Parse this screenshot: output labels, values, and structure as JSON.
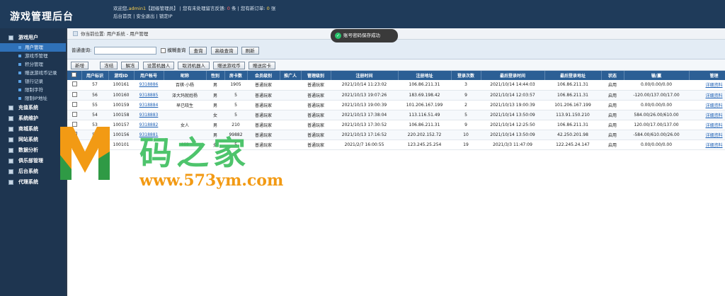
{
  "app": {
    "title": "游戏管理后台"
  },
  "header": {
    "welcome_prefix": "欢迎您,",
    "user": "admin1",
    "role": "【超级管理员】",
    "sep1": "|",
    "msg_prefix": "您有未处理留言反馈:",
    "msg_count": "0",
    "msg_suffix": "条",
    "sep2": "|",
    "order_prefix": "您有新订单:",
    "order_count": "0",
    "order_suffix": "张",
    "links": [
      "后台首页",
      "|",
      "安全退出",
      "|",
      "锁定IP"
    ]
  },
  "sidebar": {
    "groups": [
      {
        "label": "游戏用户",
        "subs": [
          "用户管理",
          "游戏币管理",
          "积分管理",
          "赠送游戏币记录",
          "银行记录",
          "限制字符",
          "限制IP地址"
        ]
      },
      {
        "label": "充值系统"
      },
      {
        "label": "系统维护"
      },
      {
        "label": "商城系统"
      },
      {
        "label": "网站系统"
      },
      {
        "label": "数据分析"
      },
      {
        "label": "俱乐部管理"
      },
      {
        "label": "后台系统"
      },
      {
        "label": "代理系统"
      }
    ],
    "active_sub": "用户管理"
  },
  "breadcrumb": "你当前位置: 用户系统 - 用户管理",
  "search": {
    "label": "普通查询:",
    "value": "",
    "fuzzy_label": "模糊查询",
    "query_btn": "查询",
    "advanced_btn": "高级查询",
    "refresh_btn": "刷新"
  },
  "toolbar": {
    "buttons": [
      "新增",
      "冻结",
      "解冻",
      "设置机器人",
      "取消机器人",
      "赠送游戏币",
      "赠送房卡"
    ]
  },
  "toast": "账号密码保存成功",
  "table": {
    "headers": [
      "",
      "用户标识",
      "游戏ID",
      "用户帐号",
      "昵称",
      "性别",
      "房卡数",
      "会员级别",
      "推广人",
      "管理级别",
      "注册时间",
      "注册地址",
      "登录次数",
      "最后登录时间",
      "最后登录地址",
      "状态",
      "输/赢",
      "管理"
    ],
    "rows": [
      [
        "",
        "57",
        "100161",
        "9318886",
        "百棋·小杨",
        "男",
        "1905",
        "普通玩家",
        "",
        "普通玩家",
        "2021/10/14 11:23:02",
        "106.86.211.31",
        "3",
        "2021/10/14 14:44:03",
        "106.86.211.31",
        "启用",
        "0.00/0.00/0.00",
        "详细资料"
      ],
      [
        "",
        "56",
        "100160",
        "9318885",
        "泽大玛就姓杨",
        "男",
        "5",
        "普通玩家",
        "",
        "普通玩家",
        "2021/10/13 19:07:26",
        "183.69.198.42",
        "9",
        "2021/10/14 12:03:57",
        "106.86.211.31",
        "启用",
        "-120.00/137.00/17.00",
        "详细资料"
      ],
      [
        "",
        "55",
        "100159",
        "9318884",
        "早已晓生",
        "男",
        "5",
        "普通玩家",
        "",
        "普通玩家",
        "2021/10/13 19:00:39",
        "101.206.167.199",
        "2",
        "2021/10/13 19:00:39",
        "101.206.167.199",
        "启用",
        "0.00/0.00/0.00",
        "详细资料"
      ],
      [
        "",
        "54",
        "100158",
        "9318883",
        "",
        "女",
        "5",
        "普通玩家",
        "",
        "普通玩家",
        "2021/10/13 17:38:04",
        "113.116.51.49",
        "5",
        "2021/10/14 13:50:09",
        "113.91.150.210",
        "启用",
        "584.00/26.00/610.00",
        "详细资料"
      ],
      [
        "",
        "53",
        "100157",
        "9318882",
        "女人",
        "男",
        "210",
        "普通玩家",
        "",
        "普通玩家",
        "2021/10/13 17:30:52",
        "106.86.211.31",
        "9",
        "2021/10/14 12:25:50",
        "106.86.211.31",
        "启用",
        "120.00/17.00/137.00",
        "详细资料"
      ],
      [
        "",
        "52",
        "100156",
        "9318881",
        "",
        "男",
        "99882",
        "普通玩家",
        "",
        "普通玩家",
        "2021/10/13 17:16:52",
        "220.202.152.72",
        "10",
        "2021/10/14 13:50:09",
        "42.250.201.98",
        "启用",
        "-584.00/610.00/26.00",
        "详细资料"
      ],
      [
        "",
        "1",
        "100101",
        "",
        "469",
        "女",
        "5",
        "普通玩家",
        "",
        "普通玩家",
        "2021/2/7 16:00:55",
        "123.245.25.254",
        "19",
        "2021/3/3 11:47:09",
        "122.245.24.147",
        "启用",
        "0.00/0.00/0.00",
        "详细资料"
      ]
    ]
  },
  "watermark": {
    "brand": "码之家",
    "url": "www.573ym.com"
  }
}
